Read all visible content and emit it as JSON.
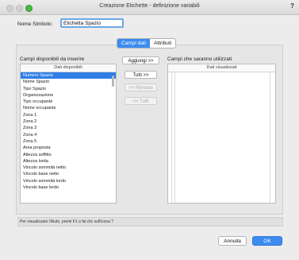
{
  "window": {
    "title": "Creazione Etichette - definizione variabili",
    "help": "?"
  },
  "name_field": {
    "label": "Nome Simbolo:",
    "value": "Etichetta Spazio"
  },
  "tabs": [
    {
      "label": "Campi dati",
      "active": true
    },
    {
      "label": "Attributi",
      "active": false
    }
  ],
  "available": {
    "title": "Campi disponibili da inserire",
    "header": "Dati disponibili",
    "items": [
      "Numero Spazio",
      "Nome Spazio",
      "Tipo Spazio",
      "Organizzazione",
      "Tipo occupante",
      "Nome occupante",
      "Zona 1",
      "Zona 2",
      "Zona 3",
      "Zona 4",
      "Zona 5",
      "Area proposta",
      "Altezza soffitto",
      "Altezza lorda",
      "Vincolo sommità netto",
      "Vincolo base netto",
      "Vincolo sommità lordo",
      "Vincolo base lordo"
    ],
    "selected_index": 0
  },
  "actions": {
    "add": "Aggiungi >>",
    "all": "Tutti >>",
    "remove": "<< Rimuovi",
    "remove_all": "<< Tutti"
  },
  "used": {
    "title": "Campi che saranno utilizzati",
    "header": "Dati visualizzati"
  },
  "status": "Per visualizzare l'Aiuto, premi F1 o fai clic sull'icona ?",
  "footer": {
    "cancel": "Annulla",
    "ok": "OK"
  }
}
